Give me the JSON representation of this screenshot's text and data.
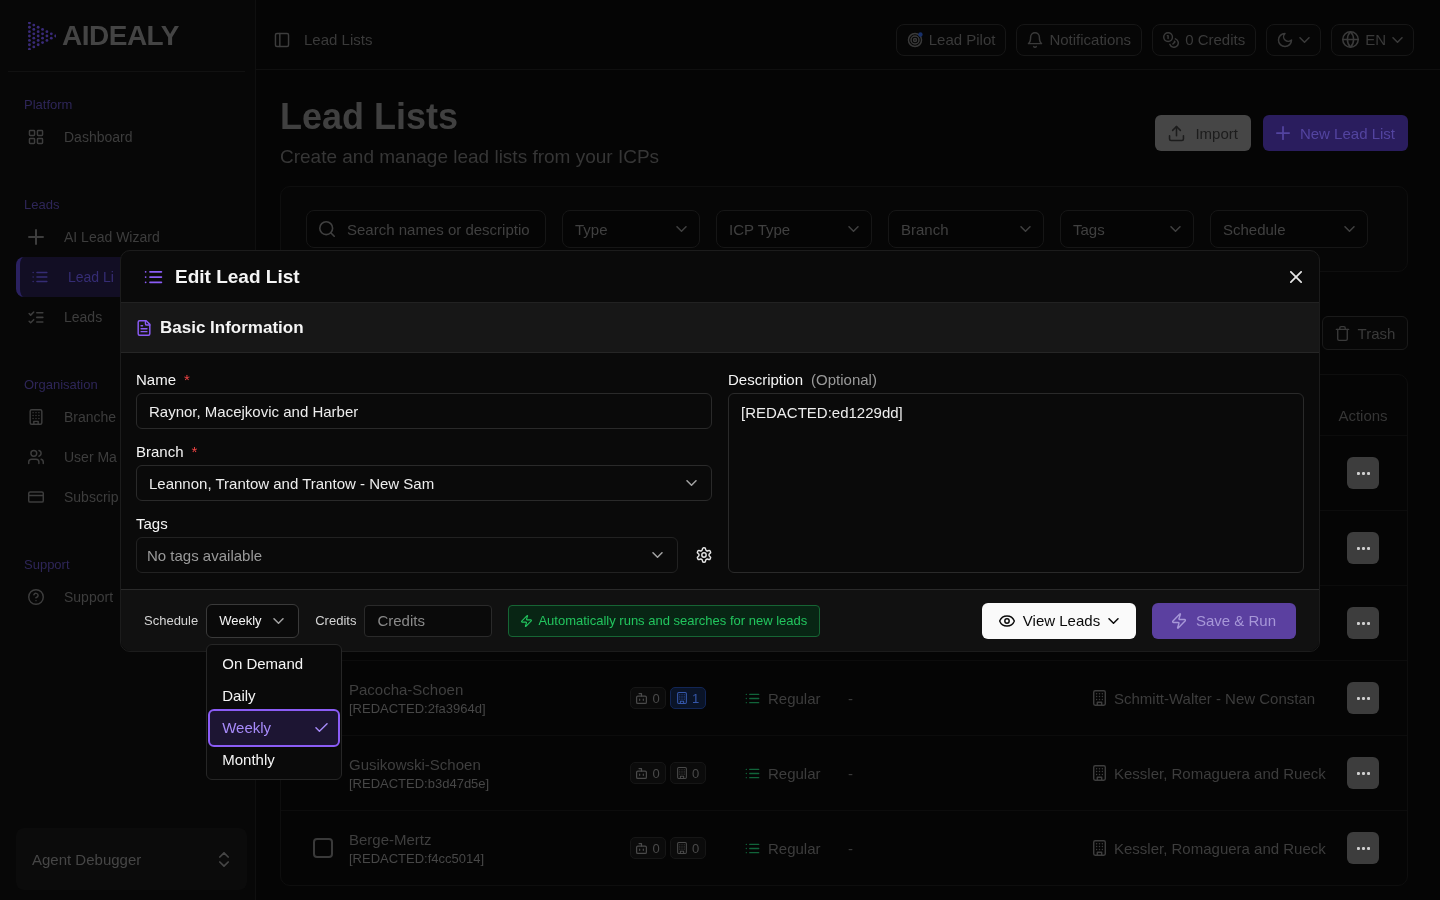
{
  "sidebar": {
    "logo": "AIDEALY",
    "groups": [
      {
        "label": "Platform",
        "items": [
          {
            "label": "Dashboard",
            "selected": false
          }
        ]
      },
      {
        "label": "Leads",
        "items": [
          {
            "label": "AI Lead Wizard",
            "selected": false
          },
          {
            "label": "Lead Li",
            "selected": true
          },
          {
            "label": "Leads",
            "selected": false
          }
        ]
      },
      {
        "label": "Organisation",
        "items": [
          {
            "label": "Branche",
            "selected": false
          },
          {
            "label": "User Ma",
            "selected": false
          },
          {
            "label": "Subscrip",
            "selected": false
          }
        ]
      },
      {
        "label": "Support",
        "items": [
          {
            "label": "Support",
            "selected": false
          }
        ]
      }
    ],
    "footer": "Agent Debugger"
  },
  "header": {
    "breadcrumb": "Lead Lists",
    "buttons": [
      {
        "label": "Lead Pilot"
      },
      {
        "label": "Notifications"
      },
      {
        "label": "0 Credits"
      }
    ],
    "language": "EN"
  },
  "page": {
    "title": "Lead Lists",
    "subtitle": "Create and manage lead lists from your ICPs",
    "actions": [
      {
        "label": "Import",
        "kind": "secondary"
      },
      {
        "label": "New Lead List",
        "kind": "primary"
      }
    ]
  },
  "filters": {
    "search": {
      "placeholder": "Search names or descriptio"
    },
    "selects": [
      {
        "placeholder": "Type"
      },
      {
        "placeholder": "ICP Type"
      },
      {
        "placeholder": "Branch"
      },
      {
        "placeholder": "Tags"
      },
      {
        "placeholder": "Schedule"
      }
    ]
  },
  "table": {
    "trash_button": "Trash",
    "actions_heading": "Actions",
    "rows": [
      {
        "kind": "covered"
      },
      {
        "kind": "covered"
      },
      {
        "kind": "covered"
      },
      {
        "kind": "full",
        "column_2": {
          "title": "Pacocha-Schoen",
          "subtitle": "[REDACTED:2fa3964d]"
        },
        "column_3": [
          {
            "value": "0",
            "active": false
          },
          {
            "value": "1",
            "active": true
          }
        ],
        "column_4": "Regular",
        "column_5": "-",
        "column_6": "Schmitt-Walter - New Constan"
      },
      {
        "kind": "full",
        "column_2": {
          "title": "Gusikowski-Schoen",
          "subtitle": "[REDACTED:b3d47d5e]"
        },
        "column_3": [
          {
            "value": "0",
            "active": false
          },
          {
            "value": "0",
            "active": false
          }
        ],
        "column_4": "Regular",
        "column_5": "-",
        "column_6": "Kessler, Romaguera and Rueck"
      },
      {
        "kind": "full",
        "checked": false,
        "column_2": {
          "title": "Berge-Mertz",
          "subtitle": "[REDACTED:f4cc5014]"
        },
        "column_3": [
          {
            "value": "0",
            "active": false
          },
          {
            "value": "0",
            "active": false
          }
        ],
        "column_4": "Regular",
        "column_5": "-",
        "column_6": "Kessler, Romaguera and Rueck"
      }
    ]
  },
  "dialog": {
    "title": "Edit Lead List",
    "section": "Basic Information",
    "fields": [
      {
        "kind": "text",
        "label": "Name",
        "required_mark": "*",
        "value": "Raynor, Macejkovic and Harber"
      },
      {
        "kind": "select",
        "label": "Branch",
        "required_mark": "*",
        "value": "Leannon, Trantow and Trantow - New Sam"
      },
      {
        "kind": "tags",
        "label": "Tags",
        "placeholder": "No tags available"
      }
    ],
    "description": {
      "label": "Description",
      "hint": "(Optional)",
      "value": "[REDACTED:ed1229dd]"
    },
    "footer": {
      "schedule": {
        "label": "Schedule",
        "value": "Weekly",
        "expanded": true,
        "options": [
          {
            "label": "On Demand",
            "selected": false
          },
          {
            "label": "Daily",
            "selected": false
          },
          {
            "label": "Weekly",
            "selected": true
          },
          {
            "label": "Monthly",
            "selected": false
          }
        ]
      },
      "credits": {
        "label": "Credits",
        "placeholder": "Credits"
      },
      "notice": "Automatically runs and searches for new leads",
      "view_button": "View Leads",
      "save_button": {
        "label": "Save & Run",
        "disabled": true
      }
    }
  }
}
